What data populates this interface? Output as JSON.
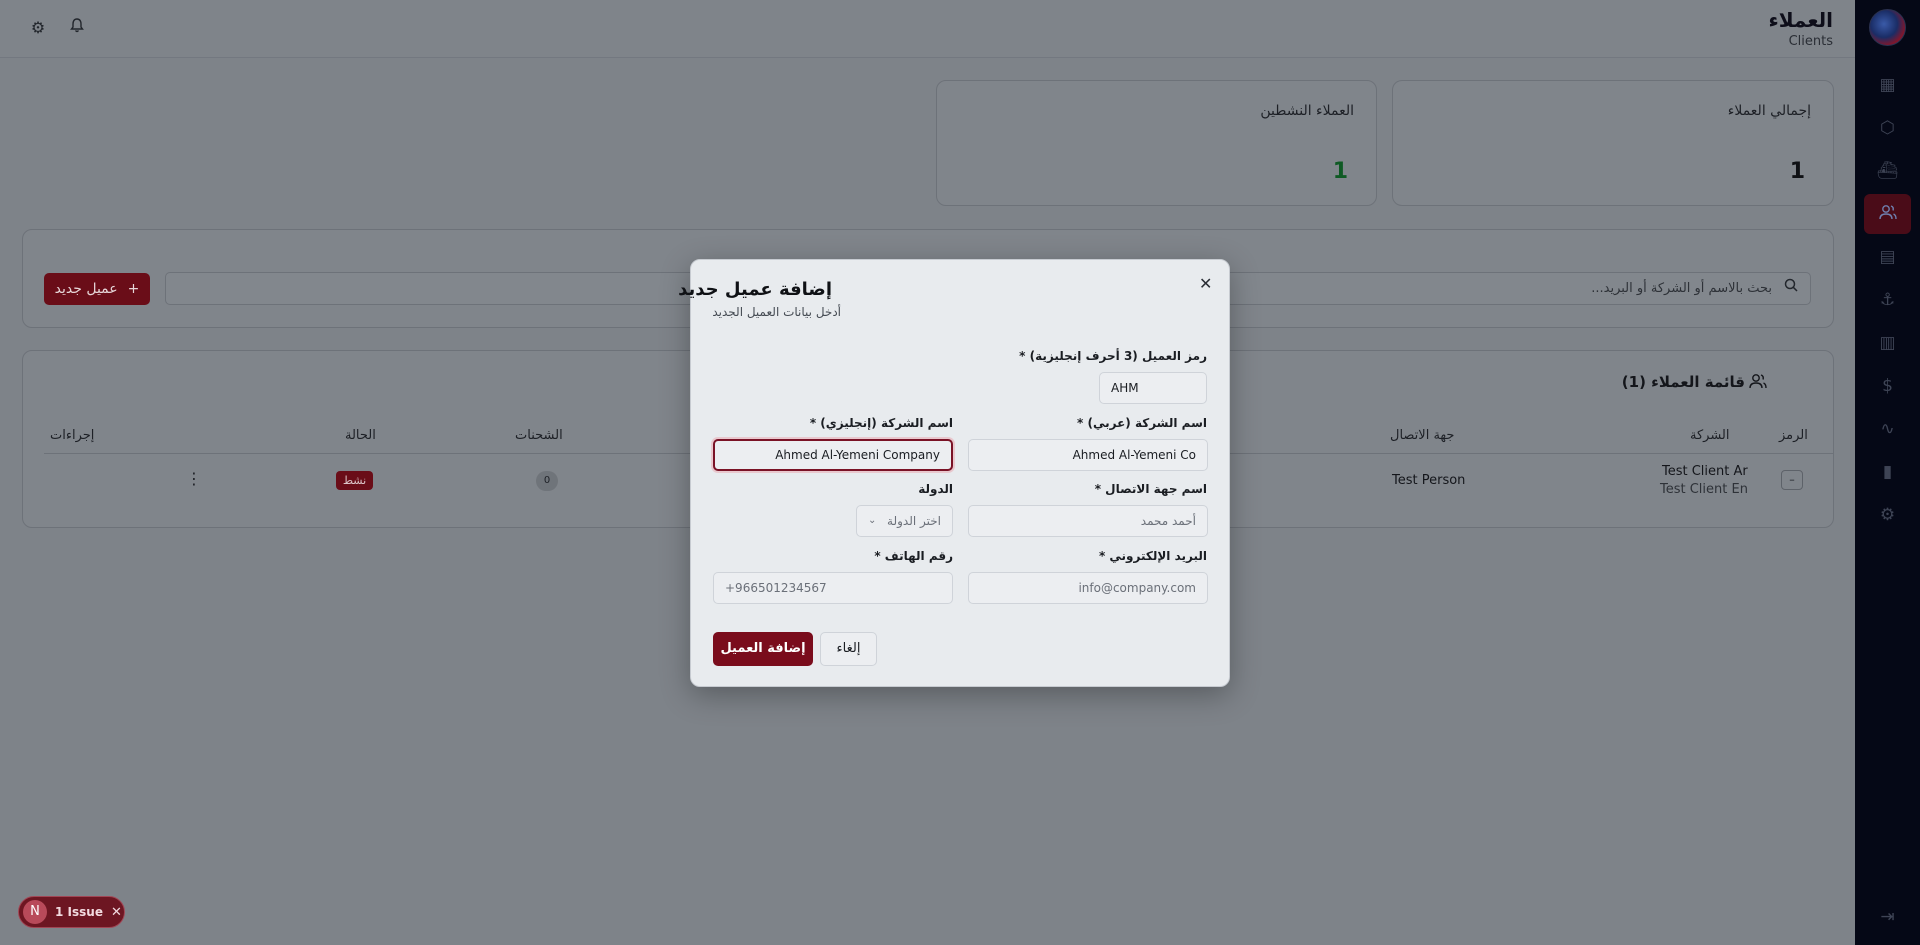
{
  "header": {
    "title_ar": "العملاء",
    "title_en": "Clients"
  },
  "stats": [
    {
      "label": "إجمالي العملاء",
      "value": "1"
    },
    {
      "label": "العملاء النشطين",
      "value": "1"
    }
  ],
  "toolbar": {
    "new_client_label": "عميل جديد",
    "search_placeholder": "بحث بالاسم أو الشركة أو البريد..."
  },
  "list": {
    "title": "قائمة العملاء (1)",
    "columns": {
      "code": "الرمز",
      "company": "الشركة",
      "contact": "جهة الاتصال",
      "shipments": "الشحنات",
      "status": "الحالة",
      "actions": "إجراءات"
    },
    "rows": [
      {
        "code": "–",
        "company_ar": "Test Client Ar",
        "company_en": "Test Client En",
        "contact": "Test Person",
        "shipments": "0",
        "status": "نشط"
      }
    ]
  },
  "modal": {
    "title": "إضافة عميل جديد",
    "subtitle": "أدخل بيانات العميل الجديد",
    "fields": {
      "code_label": "رمز العميل (3 أحرف إنجليزية) *",
      "code_value": "AHM",
      "name_ar_label": "اسم الشركة (عربي) *",
      "name_ar_value": "Ahmed Al-Yemeni Co",
      "name_en_label": "اسم الشركة (إنجليزي) *",
      "name_en_value": "Ahmed Al-Yemeni Company",
      "contact_label": "اسم جهة الاتصال *",
      "contact_placeholder": "أحمد محمد",
      "country_label": "الدولة",
      "country_placeholder": "اختر الدولة",
      "email_label": "البريد الإلكتروني *",
      "email_placeholder": "info@company.com",
      "phone_label": "رقم الهاتف *",
      "phone_placeholder": "+966501234567"
    },
    "submit_label": "إضافة العميل",
    "cancel_label": "إلغاء"
  },
  "issue": {
    "badge": "N",
    "label": "1 Issue"
  },
  "colors": {
    "accent": "#7a0c1c",
    "sidebar": "#050816",
    "frame": "#1f62e8"
  }
}
